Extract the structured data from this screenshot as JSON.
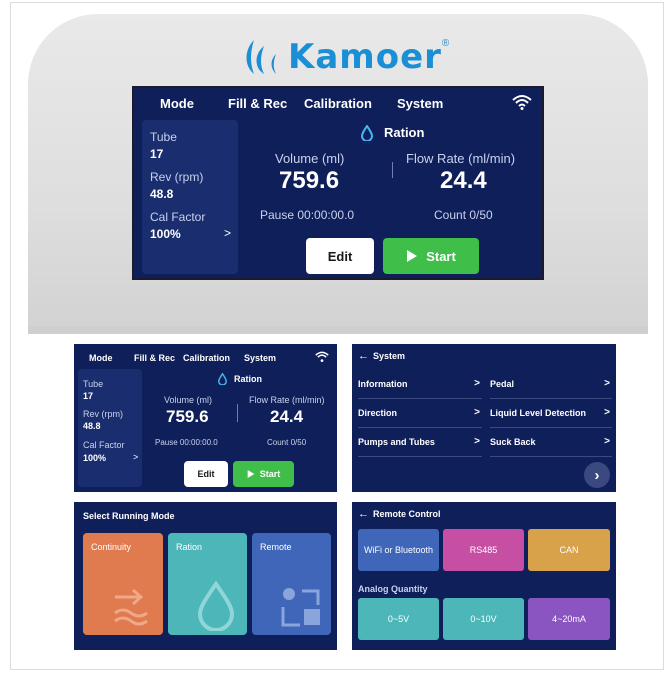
{
  "brand": {
    "name": "Kamoer",
    "trademark": "®",
    "color": "#1a8fd6"
  },
  "main_screen": {
    "nav": [
      "Mode",
      "Fill & Rec",
      "Calibration",
      "System"
    ],
    "wifi_icon": "wifi-icon",
    "side": {
      "tube_label": "Tube",
      "tube_value": "17",
      "rev_label": "Rev (rpm)",
      "rev_value": "48.8",
      "cal_label": "Cal Factor",
      "cal_value": "100%",
      "cal_chevron": ">"
    },
    "mode_title": "Ration",
    "volume_label": "Volume (ml)",
    "volume_value": "759.6",
    "flow_label": "Flow Rate (ml/min)",
    "flow_value": "24.4",
    "pause": "Pause 00:00:00.0",
    "count": "Count 0/50",
    "edit": "Edit",
    "start": "Start"
  },
  "system_panel": {
    "back": "←",
    "title": "System",
    "items_left": [
      "Information",
      "Direction",
      "Pumps and Tubes"
    ],
    "items_right": [
      "Pedal",
      "Liquid Level Detection",
      "Suck Back"
    ],
    "chevron": ">",
    "next": "›"
  },
  "mode_panel": {
    "title": "Select Running Mode",
    "tiles": [
      {
        "label": "Continuity",
        "color": "#e07a4f",
        "icon": "waves-arrow-icon"
      },
      {
        "label": "Ration",
        "color": "#4cb6b9",
        "icon": "droplet-icon"
      },
      {
        "label": "Remote",
        "color": "#3f66b8",
        "icon": "remote-icon"
      }
    ]
  },
  "remote_panel": {
    "back": "←",
    "title": "Remote Control",
    "row1": [
      {
        "label": "WiFi or Bluetooth",
        "color": "#3f66b8"
      },
      {
        "label": "RS485",
        "color": "#c64ea3"
      },
      {
        "label": "CAN",
        "color": "#d8a24a"
      }
    ],
    "analog_label": "Analog Quantity",
    "row2": [
      {
        "label": "0~5V",
        "color": "#4cb6b9"
      },
      {
        "label": "0~10V",
        "color": "#4cb6b9"
      },
      {
        "label": "4~20mA",
        "color": "#8a55c0"
      }
    ]
  }
}
